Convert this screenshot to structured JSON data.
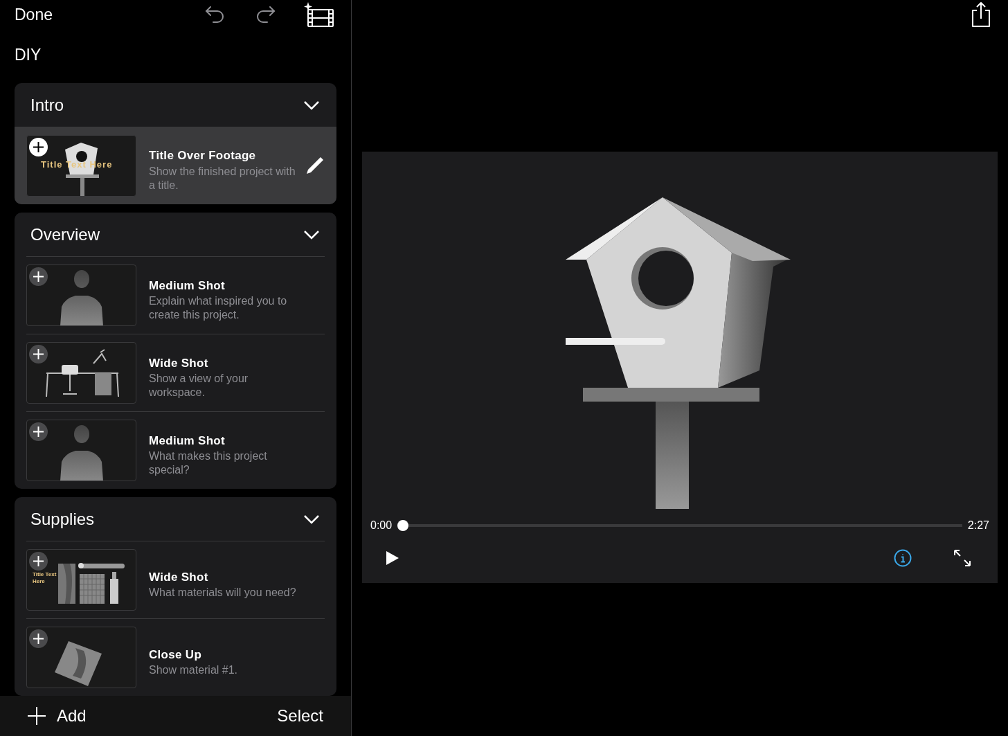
{
  "toolbar": {
    "done": "Done"
  },
  "project_title": "DIY",
  "sections": [
    {
      "title": "Intro",
      "expanded": true,
      "clips": [
        {
          "kind": "birdhouse",
          "thumbnail_text": "Title Text Here",
          "title": "Title Over Footage",
          "description": "Show the finished project with a title.",
          "selected": true
        }
      ]
    },
    {
      "title": "Overview",
      "expanded": true,
      "clips": [
        {
          "kind": "person",
          "title": "Medium Shot",
          "description": "Explain what inspired you to create this project.",
          "selected": false
        },
        {
          "kind": "desk",
          "title": "Wide Shot",
          "description": "Show a view of your workspace.",
          "selected": false
        },
        {
          "kind": "person",
          "title": "Medium Shot",
          "description": "What makes this project special?",
          "selected": false
        }
      ]
    },
    {
      "title": "Supplies",
      "expanded": true,
      "clips": [
        {
          "kind": "supplies",
          "thumbnail_text": "Title Text Here",
          "title": "Wide Shot",
          "description": "What materials will you need?",
          "selected": false
        },
        {
          "kind": "material",
          "title": "Close Up",
          "description": "Show material #1.",
          "selected": false
        }
      ]
    }
  ],
  "bottom_bar": {
    "add": "Add",
    "select": "Select"
  },
  "player": {
    "current_time": "0:00",
    "duration": "2:27",
    "level": 0
  }
}
